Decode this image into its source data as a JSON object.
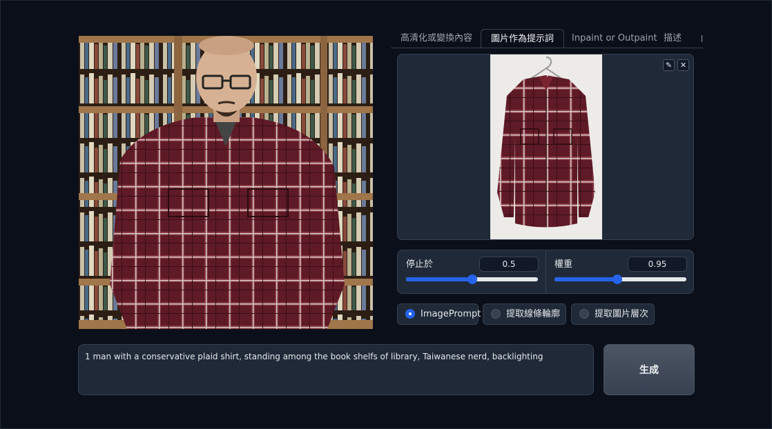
{
  "tabs": [
    {
      "label": "高清化或變換內容",
      "active": false
    },
    {
      "label": "圖片作為提示詞",
      "active": true
    },
    {
      "label": "Inpaint or Outpaint",
      "active": false
    },
    {
      "label": "描述",
      "active": false
    },
    {
      "label": "",
      "active": false
    }
  ],
  "image_prompt": {
    "edit_icon": "pencil-icon",
    "clear_icon": "close-icon",
    "edit_glyph": "✎",
    "clear_glyph": "✕"
  },
  "sliders": {
    "stop_at": {
      "label": "停止於",
      "value": "0.5",
      "fraction": 0.5
    },
    "weight": {
      "label": "權重",
      "value": "0.95",
      "fraction": 0.475
    }
  },
  "options": [
    {
      "label": "ImagePrompt",
      "checked": true
    },
    {
      "label": "提取線條輪廓",
      "checked": false
    },
    {
      "label": "提取圖片層次",
      "checked": false
    }
  ],
  "prompt": {
    "value": "1 man with a conservative plaid shirt, standing among the book shelfs of library, Taiwanese nerd, backlighting"
  },
  "generate": {
    "label": "生成"
  },
  "colors": {
    "background": "#0b0f19",
    "panel": "#1f2937",
    "accent": "#2563eb",
    "shirt_red": "#6b1c28"
  }
}
